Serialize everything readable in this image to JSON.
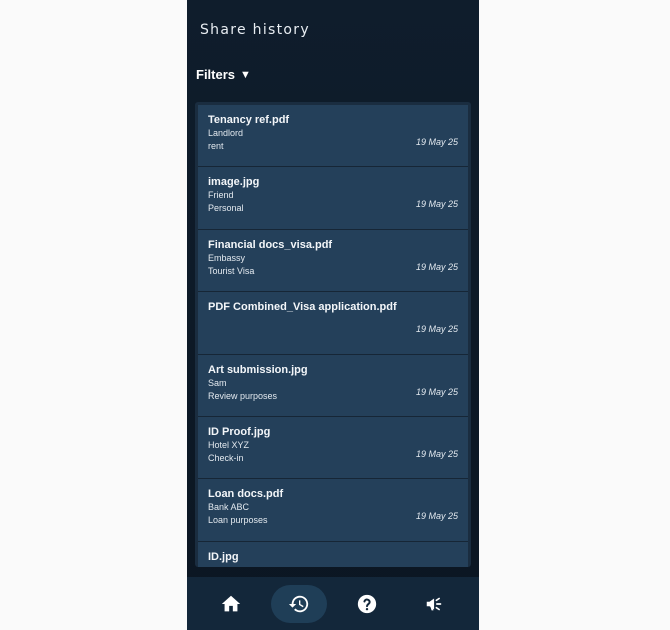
{
  "header": {
    "title": "Share history"
  },
  "filters": {
    "label": "Filters",
    "caret": "▼"
  },
  "items": [
    {
      "name": "Tenancy ref.pdf",
      "recipient": "Landlord",
      "purpose": "rent",
      "date": "19 May 25"
    },
    {
      "name": "image.jpg",
      "recipient": "Friend",
      "purpose": "Personal",
      "date": "19 May 25"
    },
    {
      "name": "Financial docs_visa.pdf",
      "recipient": "Embassy",
      "purpose": "Tourist Visa",
      "date": "19 May 25"
    },
    {
      "name": "PDF Combined_Visa application.pdf",
      "recipient": "",
      "purpose": "",
      "date": "19 May 25"
    },
    {
      "name": "Art submission.jpg",
      "recipient": "Sam",
      "purpose": "Review purposes",
      "date": "19 May 25"
    },
    {
      "name": "ID Proof.jpg",
      "recipient": "Hotel XYZ",
      "purpose": "Check-in",
      "date": "19 May 25"
    },
    {
      "name": "Loan docs.pdf",
      "recipient": "Bank ABC",
      "purpose": "Loan purposes",
      "date": "19 May 25"
    },
    {
      "name": "ID.jpg",
      "recipient": "",
      "purpose": "",
      "date": ""
    }
  ],
  "nav": [
    {
      "icon": "home-icon",
      "active": false
    },
    {
      "icon": "history-icon",
      "active": true
    },
    {
      "icon": "help-icon",
      "active": false
    },
    {
      "icon": "megaphone-icon",
      "active": false
    }
  ],
  "colors": {
    "background": "#0f1d2c",
    "card": "#24405a",
    "nav": "#13273a",
    "active_pill": "#1f3e57"
  }
}
